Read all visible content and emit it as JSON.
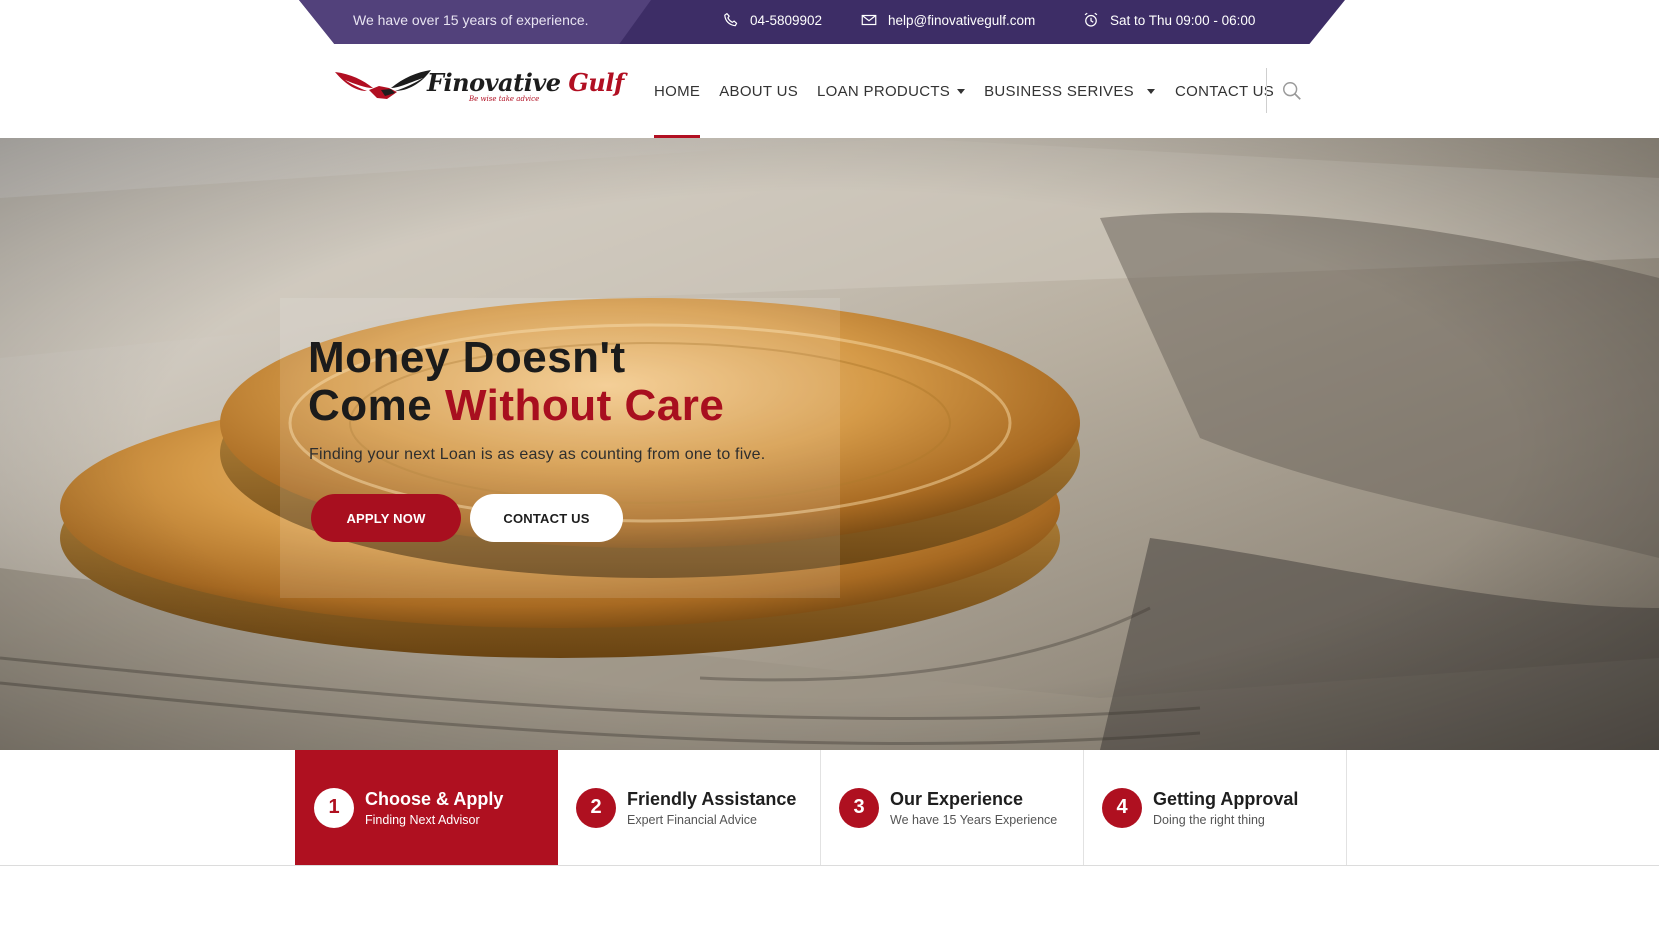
{
  "topbar": {
    "experience_text": "We have over 15 years of experience.",
    "phone": "04-5809902",
    "email": "help@finovativegulf.com",
    "hours": "Sat to Thu 09:00 - 06:00",
    "bg_color": "#3d2d66",
    "icons": {
      "phone": "phone-icon",
      "email": "envelope-icon",
      "hours": "alarm-clock-icon"
    }
  },
  "header": {
    "logo_name_main": "Finovative",
    "logo_name_accent": "Gulf",
    "logo_tagline": "Be wise take advice",
    "nav": [
      {
        "label": "HOME",
        "active": true
      },
      {
        "label": "ABOUT US",
        "active": false
      },
      {
        "label": "LOAN PRODUCTS",
        "dropdown": true
      },
      {
        "label": "BUSINESS SERIVES",
        "dropdown": true
      },
      {
        "label": "CONTACT US",
        "active": false
      }
    ],
    "search_icon": "search-icon"
  },
  "hero": {
    "title_line1": "Money Doesn't",
    "title_line2_plain": "Come",
    "title_line2_accent": "Without Care",
    "subtitle": "Finding your next Loan is as easy as counting from one to five.",
    "apply_button": "APPLY NOW",
    "contact_button": "CONTACT US"
  },
  "steps": [
    {
      "number": "1",
      "title": "Choose & Apply",
      "subtitle": "Finding Next Advisor",
      "active": true
    },
    {
      "number": "2",
      "title": "Friendly Assistance",
      "subtitle": "Expert Financial Advice"
    },
    {
      "number": "3",
      "title": "Our Experience",
      "subtitle": "We have 15 Years Experience"
    },
    {
      "number": "4",
      "title": "Getting Approval",
      "subtitle": "Doing the right thing"
    }
  ],
  "colors": {
    "brand_red": "#af1020",
    "brand_purple": "#3d2d66"
  }
}
